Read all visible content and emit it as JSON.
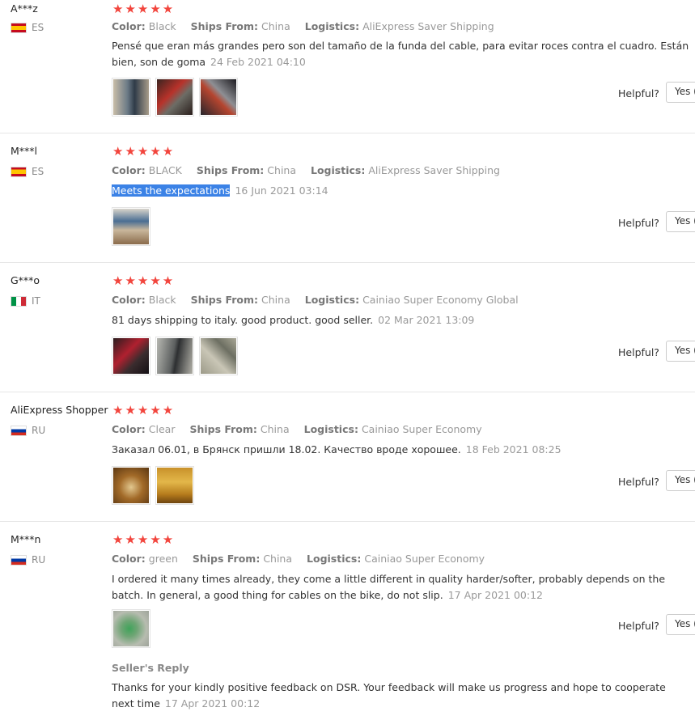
{
  "reviews": [
    {
      "user": "A***z",
      "country": "ES",
      "rating": 5,
      "color_label": "Color:",
      "color": "Black",
      "ships_label": "Ships From:",
      "ships": "China",
      "logistics_label": "Logistics:",
      "logistics": "AliExpress Saver Shipping",
      "text": "Pensé que eran más grandes pero son del tamaño de la funda del cable, para evitar roces contra el cuadro. Están bien, son de goma",
      "date": "24 Feb 2021 04:10",
      "helpful": "Helpful?",
      "yes": "Yes (",
      "photo_count": 3
    },
    {
      "user": "M***l",
      "country": "ES",
      "rating": 5,
      "color_label": "Color:",
      "color": "BLACK",
      "ships_label": "Ships From:",
      "ships": "China",
      "logistics_label": "Logistics:",
      "logistics": "AliExpress Saver Shipping",
      "text": "Meets the expectations",
      "date": "16 Jun 2021 03:14",
      "helpful": "Helpful?",
      "yes": "Yes (",
      "photo_count": 1
    },
    {
      "user": "G***o",
      "country": "IT",
      "rating": 5,
      "color_label": "Color:",
      "color": "Black",
      "ships_label": "Ships From:",
      "ships": "China",
      "logistics_label": "Logistics:",
      "logistics": "Cainiao Super Economy Global",
      "text": "81 days shipping to italy. good product. good seller.",
      "date": "02 Mar 2021 13:09",
      "helpful": "Helpful?",
      "yes": "Yes (",
      "photo_count": 3
    },
    {
      "user": "AliExpress Shopper",
      "country": "RU",
      "rating": 5,
      "color_label": "Color:",
      "color": "Clear",
      "ships_label": "Ships From:",
      "ships": "China",
      "logistics_label": "Logistics:",
      "logistics": "Cainiao Super Economy",
      "text": "Заказал 06.01, в Брянск пришли 18.02. Качество вроде хорошее.",
      "date": "18 Feb 2021 08:25",
      "helpful": "Helpful?",
      "yes": "Yes (",
      "photo_count": 2
    },
    {
      "user": "M***n",
      "country": "RU",
      "rating": 5,
      "color_label": "Color:",
      "color": "green",
      "ships_label": "Ships From:",
      "ships": "China",
      "logistics_label": "Logistics:",
      "logistics": "Cainiao Super Economy",
      "text": "I ordered it many times already, they come a little different in quality harder/softer, probably depends on the batch. In general, a good thing for cables on the bike, do not slip.",
      "date": "17 Apr 2021 00:12",
      "helpful": "Helpful?",
      "yes": "Yes (",
      "photo_count": 1,
      "seller_reply_title": "Seller's Reply",
      "seller_reply_text": "Thanks for your kindly positive feedback on DSR. Your feedback will make us progress and hope to cooperate next time",
      "seller_reply_date": "17 Apr 2021 00:12"
    }
  ],
  "star_glyph": "★★★★★",
  "colors": {
    "star": "#f2453d",
    "highlight": "#3b82e6"
  },
  "icons": [
    "flag-es-icon",
    "flag-it-icon",
    "flag-ru-icon",
    "star-icon"
  ]
}
